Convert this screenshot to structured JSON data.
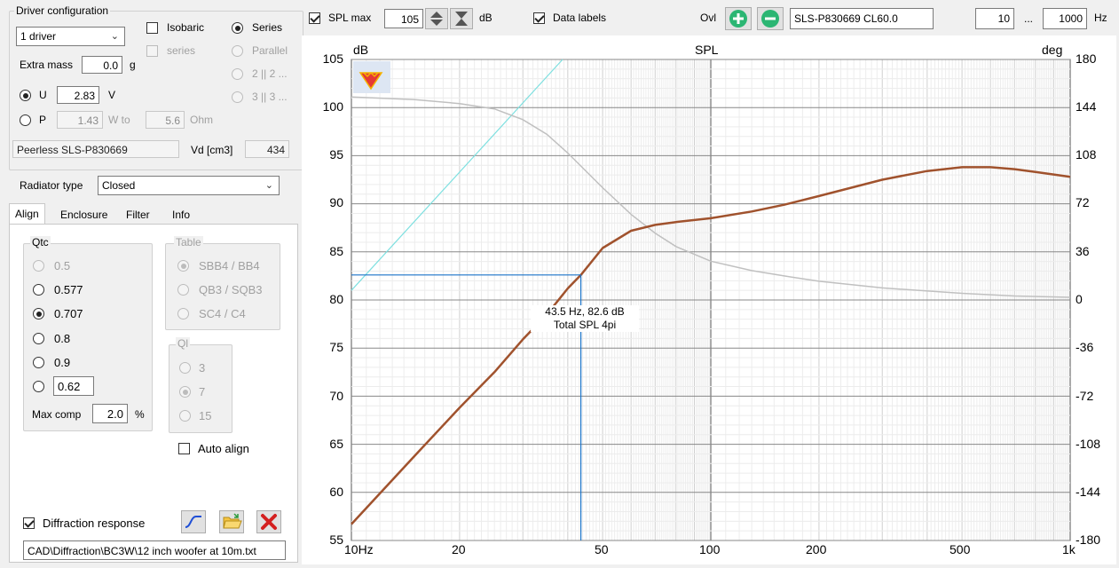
{
  "driver_config": {
    "group_title": "Driver configuration",
    "driver_count": "1 driver",
    "isobaric_label": "Isobaric",
    "isobaric_checked": false,
    "series_check_label": "series",
    "series_label": "Series",
    "parallel_label": "Parallel",
    "two_label": "2 || 2 ...",
    "three_label": "3 || 3 ...",
    "extra_mass_label": "Extra mass",
    "extra_mass_value": "0.0",
    "extra_mass_unit": "g",
    "u_label": "U",
    "u_value": "2.83",
    "u_unit": "V",
    "p_label": "P",
    "p_value": "1.43",
    "p_unit": "W to",
    "ohm_value": "5.6",
    "ohm_unit": "Ohm",
    "driver_name": "Peerless SLS-P830669",
    "vd_label": "Vd [cm3]",
    "vd_value": "434"
  },
  "radiator": {
    "label": "Radiator type",
    "value": "Closed"
  },
  "tabs": [
    {
      "label": "Align"
    },
    {
      "label": "Enclosure"
    },
    {
      "label": "Filter"
    },
    {
      "label": "Info"
    }
  ],
  "align": {
    "qtc_title": "Qtc",
    "qtc_options": [
      "0.5",
      "0.577",
      "0.707",
      "0.8",
      "0.9"
    ],
    "qtc_custom_value": "0.62",
    "max_comp_label": "Max comp",
    "max_comp_value": "2.0",
    "max_comp_unit": "%",
    "table_title": "Table",
    "table_options": [
      "SBB4 / BB4",
      "QB3 / SQB3",
      "SC4 / C4"
    ],
    "ql_title": "Ql",
    "ql_options": [
      "3",
      "7",
      "15"
    ],
    "auto_align_label": "Auto align"
  },
  "diffraction": {
    "label": "Diffraction response",
    "checked": true,
    "path": "CAD\\Diffraction\\BC3W\\12 inch woofer at 10m.txt"
  },
  "toolbar": {
    "spl_max_label": "SPL max",
    "spl_max_value": "105",
    "spl_unit": "dB",
    "data_labels_label": "Data labels",
    "ovl_label": "Ovl",
    "overlay_name": "SLS-P830669 CL60.0",
    "freq_min": "10",
    "freq_sep": "...",
    "freq_max": "1000",
    "freq_unit": "Hz"
  },
  "colors": {
    "spl_curve": "#a0522d",
    "phase_curve": "#c0c0c0",
    "reference_line": "#7de0e0",
    "cursor": "#1a73c8",
    "add_button": "#2bb673",
    "remove_button": "#2bb673",
    "delete_icon": "#d42020"
  },
  "chart_data": {
    "type": "line",
    "title": "SPL",
    "ylabel": "dB",
    "ylabel_right": "deg",
    "xscale": "log",
    "xlim": [
      10,
      1000
    ],
    "ylim": [
      55,
      105
    ],
    "ylim_right": [
      -180,
      180
    ],
    "x_tick_labels": [
      "10Hz",
      "20",
      "50",
      "100",
      "200",
      "500",
      "1k"
    ],
    "x_tick_values": [
      10,
      20,
      50,
      100,
      200,
      500,
      1000
    ],
    "y_ticks": [
      55,
      60,
      65,
      70,
      75,
      80,
      85,
      90,
      95,
      100,
      105
    ],
    "y_ticks_right": [
      -180,
      -144,
      -108,
      -72,
      -36,
      0,
      36,
      72,
      108,
      144,
      180
    ],
    "grid": true,
    "series": [
      {
        "axis": "left",
        "x": [
          10,
          15,
          20,
          25,
          30,
          35,
          40,
          43.5,
          50,
          60,
          70,
          80,
          100,
          130,
          160,
          200,
          300,
          400,
          500,
          600,
          700,
          800,
          1000
        ],
        "y": [
          56.7,
          63.8,
          68.8,
          72.5,
          75.9,
          78.5,
          81.2,
          82.6,
          85.4,
          87.2,
          87.8,
          88.1,
          88.5,
          89.2,
          89.9,
          90.8,
          92.5,
          93.4,
          93.8,
          93.8,
          93.6,
          93.3,
          92.8
        ]
      },
      {
        "axis": "right",
        "x": [
          10,
          15,
          20,
          25,
          30,
          35,
          40,
          50,
          60,
          70,
          80,
          100,
          130,
          160,
          200,
          300,
          500,
          700,
          1000
        ],
        "y": [
          152,
          150,
          147,
          143,
          135,
          124,
          110,
          84,
          64,
          50,
          40,
          29,
          22,
          18,
          14,
          9,
          5,
          3,
          2
        ]
      },
      {
        "axis": "left",
        "x": [
          10,
          38.7
        ],
        "y": [
          81,
          105
        ]
      }
    ],
    "annotations": [
      {
        "text": "43.5 Hz, 82.6 dB",
        "x": 43.5,
        "y": 82.6
      },
      {
        "text": "Total SPL 4pi",
        "x": 43.5,
        "y": 82.6
      }
    ]
  }
}
